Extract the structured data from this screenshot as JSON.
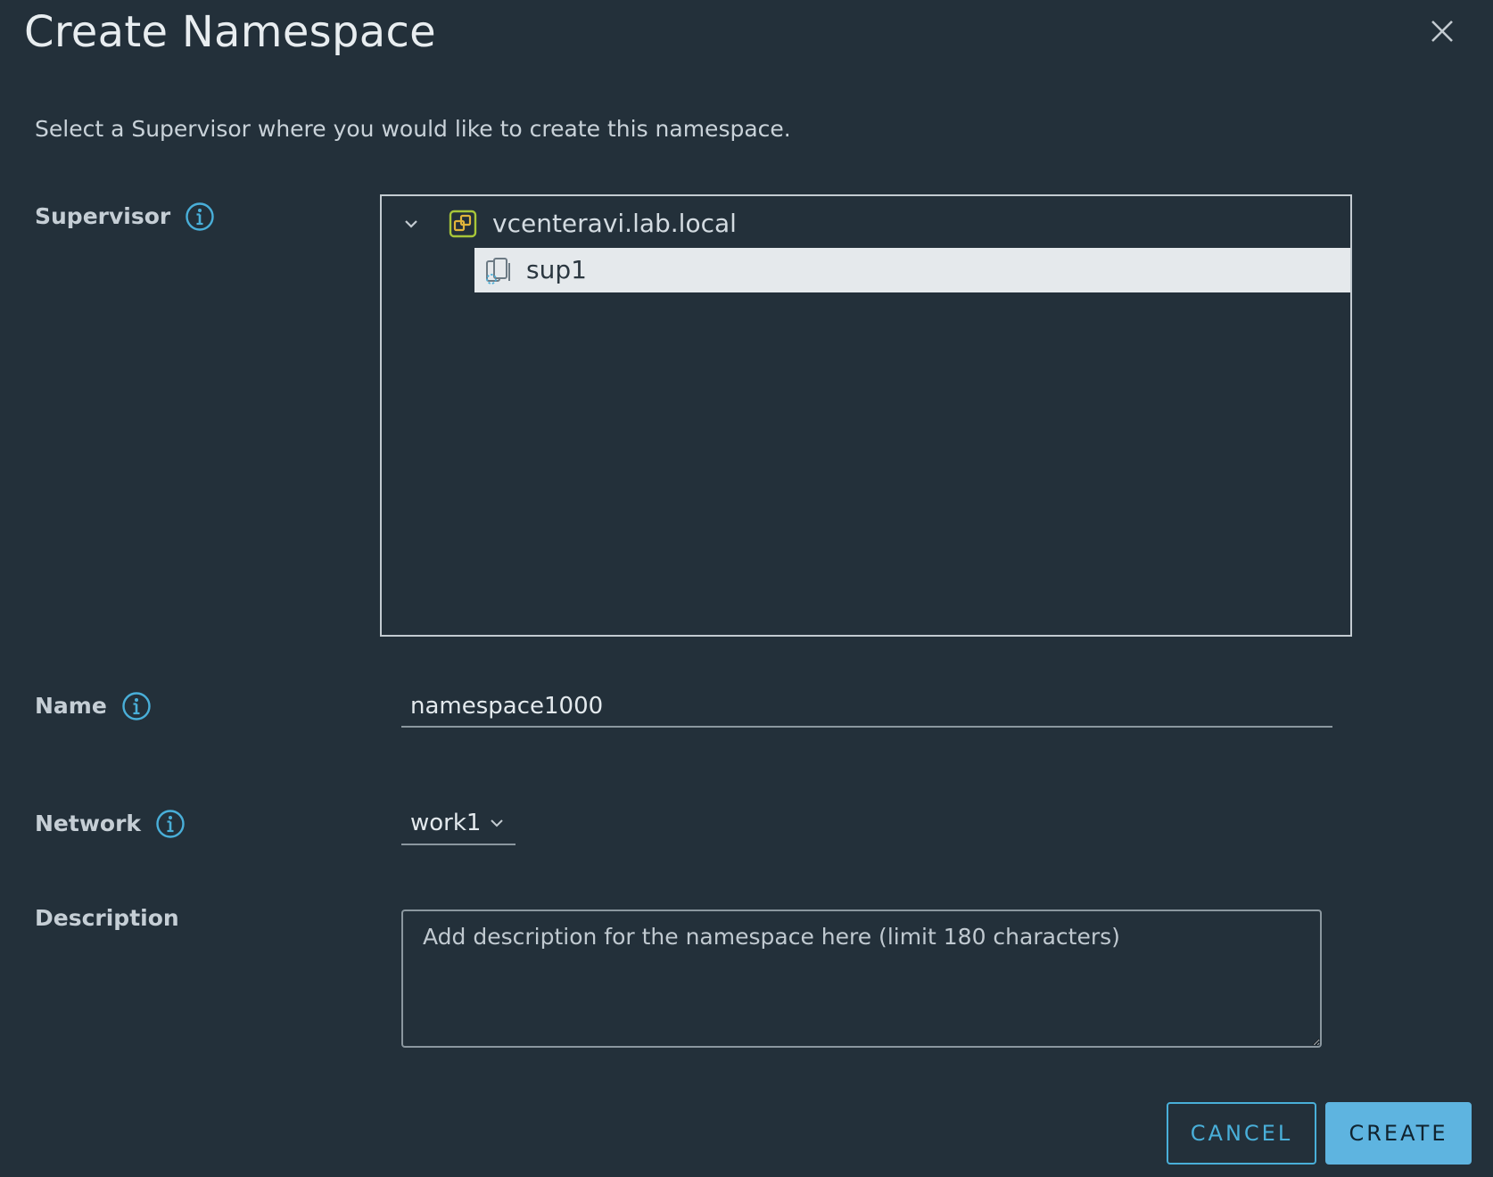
{
  "dialog": {
    "title": "Create Namespace",
    "subtitle": "Select a Supervisor where you would like to create this namespace."
  },
  "fields": {
    "supervisor_label": "Supervisor",
    "name_label": "Name",
    "network_label": "Network",
    "description_label": "Description"
  },
  "tree": {
    "root": {
      "label": "vcenteravi.lab.local",
      "icon": "vcenter-icon",
      "expanded": true
    },
    "children": [
      {
        "label": "sup1",
        "icon": "supervisor-icon",
        "selected": true
      }
    ]
  },
  "name_input": {
    "value": "namespace1000"
  },
  "network_select": {
    "value": "work1"
  },
  "description_input": {
    "value": "",
    "placeholder": "Add description for the namespace here (limit 180 characters)"
  },
  "buttons": {
    "cancel": "CANCEL",
    "create": "CREATE"
  },
  "colors": {
    "background": "#23303a",
    "primary_button": "#5eb4e0",
    "outline_button": "#49afd9",
    "selected_row": "#e5e9ec",
    "info_icon": "#49afd9",
    "vcenter_icon": "#a8c639"
  }
}
